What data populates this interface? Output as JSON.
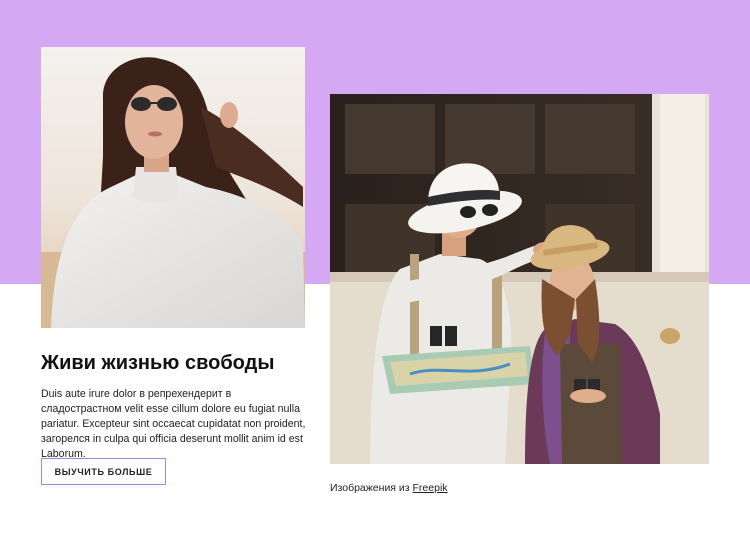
{
  "colors": {
    "band": "#d5a8f4",
    "button_border": "#b07de0",
    "text": "#222222"
  },
  "section": {
    "heading": "Живи жизнью свободы",
    "body": "Duis aute irure dolor в репрехендерит в сладострастном velit esse cillum dolore eu fugiat nulla pariatur. Excepteur sint occaecat cupidatat non proident, загорелся in culpa qui officia deserunt mollit anim id est Laborum.",
    "button_label": "ВЫУЧИТЬ БОЛЬШЕ"
  },
  "images": {
    "left_photo": "woman-in-sunglasses-photo",
    "right_photo": "travelers-with-map-photo"
  },
  "credit": {
    "prefix": "Изображения из",
    "link_label": "Freepik"
  }
}
